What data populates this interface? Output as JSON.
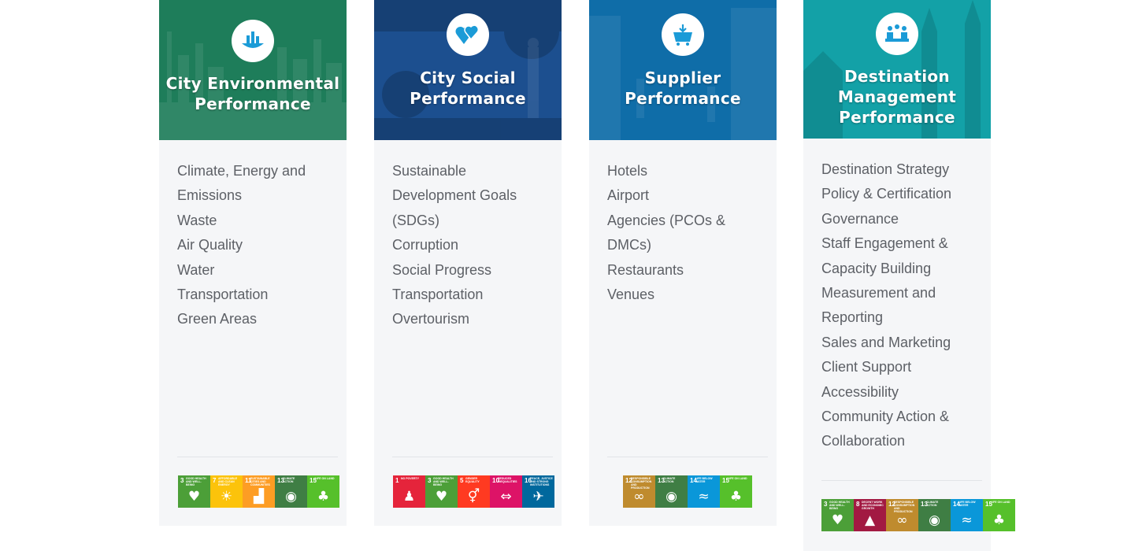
{
  "cards": [
    {
      "title_lines": [
        "City Environmental",
        "Performance"
      ],
      "icon": "city-skyline-icon",
      "hero_color": "#1e7d5a",
      "topics": [
        "Climate, Energy and",
        "Emissions",
        "Waste",
        "Air Quality",
        "Water",
        "Transportation",
        "Green Areas"
      ],
      "sdgs": [
        {
          "n": "3",
          "label": "Good health and well-being",
          "color": "#4c9f38",
          "glyph": "♥"
        },
        {
          "n": "7",
          "label": "Affordable and clean energy",
          "color": "#fcc30b",
          "glyph": "☀"
        },
        {
          "n": "11",
          "label": "Sustainable cities and communities",
          "color": "#fd9d24",
          "glyph": "▟"
        },
        {
          "n": "13",
          "label": "Climate action",
          "color": "#3f7e44",
          "glyph": "◉"
        },
        {
          "n": "15",
          "label": "Life on land",
          "color": "#56c02b",
          "glyph": "♣"
        }
      ]
    },
    {
      "title_lines": [
        "City Social",
        "Performance"
      ],
      "icon": "hearts-icon",
      "hero_color": "#1c4f8f",
      "topics": [
        "Sustainable",
        "Development Goals",
        "(SDGs)",
        "Corruption",
        "Social Progress",
        "Transportation",
        "Overtourism"
      ],
      "sdgs": [
        {
          "n": "1",
          "label": "No poverty",
          "color": "#e5243b",
          "glyph": "♟"
        },
        {
          "n": "3",
          "label": "Good health and well-being",
          "color": "#4c9f38",
          "glyph": "♥"
        },
        {
          "n": "5",
          "label": "Gender equality",
          "color": "#ff3a21",
          "glyph": "⚥"
        },
        {
          "n": "10",
          "label": "Reduced inequalities",
          "color": "#dd1367",
          "glyph": "⇔"
        },
        {
          "n": "16",
          "label": "Peace, justice and strong institutions",
          "color": "#00689d",
          "glyph": "✈"
        }
      ]
    },
    {
      "title_lines": [
        "Supplier",
        "Performance"
      ],
      "icon": "shopping-basket-icon",
      "hero_color": "#0f6da8",
      "topics": [
        "Hotels",
        "Airport",
        "Agencies (PCOs &",
        "DMCs)",
        "Restaurants",
        "Venues"
      ],
      "sdgs": [
        {
          "n": "12",
          "label": "Responsible consumption and production",
          "color": "#bf8b2e",
          "glyph": "∞"
        },
        {
          "n": "13",
          "label": "Climate action",
          "color": "#3f7e44",
          "glyph": "◉"
        },
        {
          "n": "14",
          "label": "Life below water",
          "color": "#0a97d9",
          "glyph": "≈"
        },
        {
          "n": "15",
          "label": "Life on land",
          "color": "#56c02b",
          "glyph": "♣"
        }
      ]
    },
    {
      "title_lines": [
        "Destination",
        "Management",
        "Performance"
      ],
      "icon": "meeting-table-icon",
      "hero_color": "#13a1a7",
      "topics": [
        "Destination Strategy",
        "Policy & Certification",
        "Governance",
        "Staff Engagement &",
        "Capacity Building",
        "Measurement and",
        "Reporting",
        "Sales and Marketing",
        "Client Support",
        "Accessibility",
        "Community Action &",
        "Collaboration"
      ],
      "sdgs": [
        {
          "n": "3",
          "label": "Good health and well-being",
          "color": "#4c9f38",
          "glyph": "♥"
        },
        {
          "n": "8",
          "label": "Decent work and economic growth",
          "color": "#a21942",
          "glyph": "▲"
        },
        {
          "n": "12",
          "label": "Responsible consumption and production",
          "color": "#bf8b2e",
          "glyph": "∞"
        },
        {
          "n": "13",
          "label": "Climate action",
          "color": "#3f7e44",
          "glyph": "◉"
        },
        {
          "n": "14",
          "label": "Life below water",
          "color": "#0a97d9",
          "glyph": "≈"
        },
        {
          "n": "15",
          "label": "Life on land",
          "color": "#56c02b",
          "glyph": "♣"
        }
      ]
    }
  ]
}
